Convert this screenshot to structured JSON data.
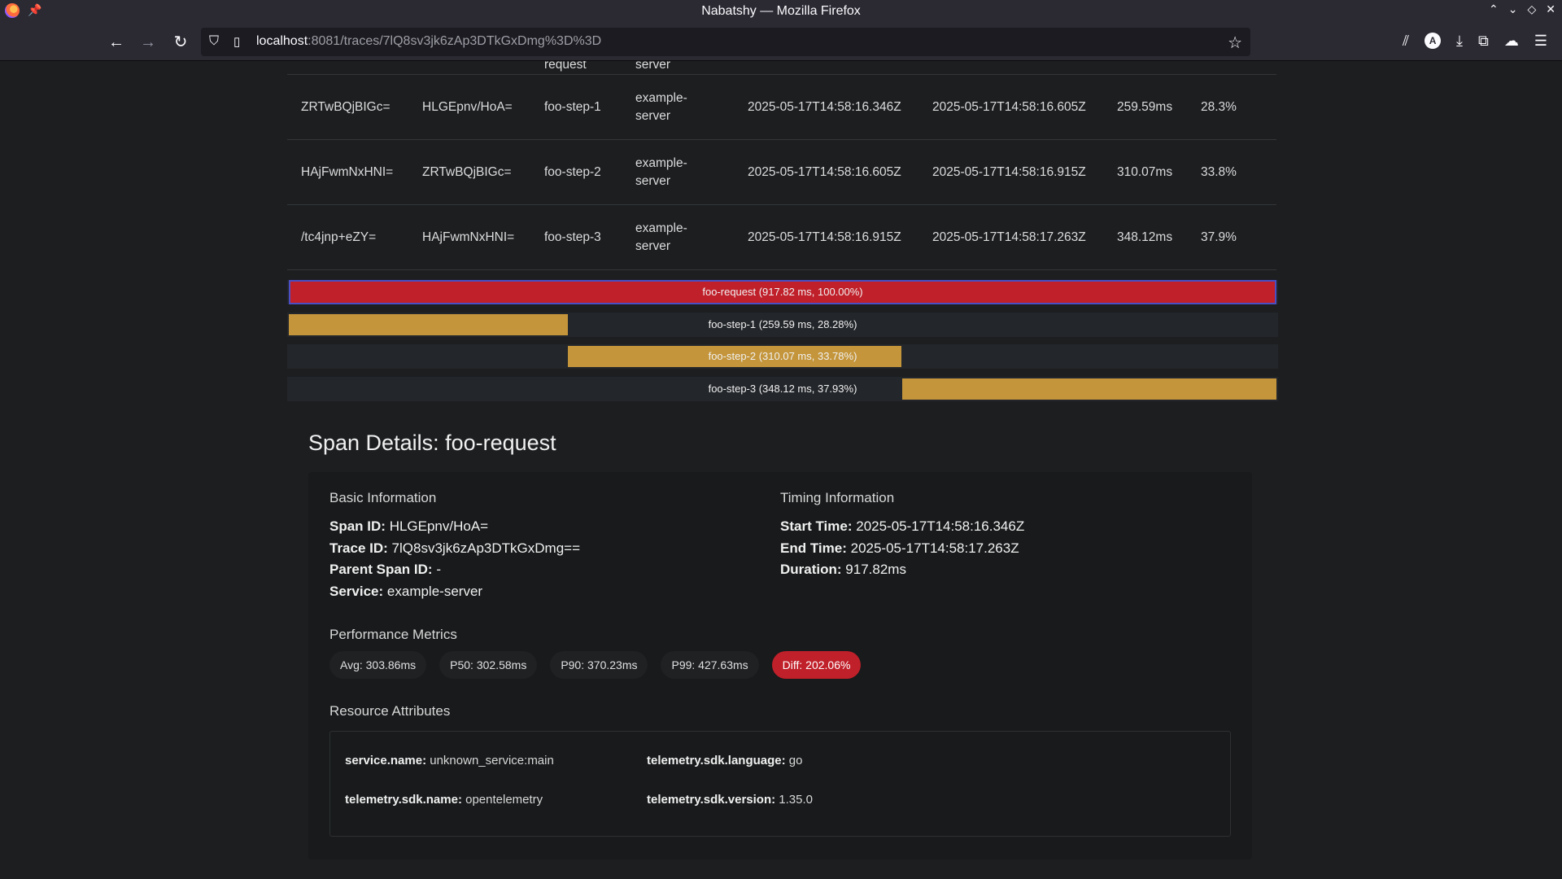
{
  "window": {
    "title": "Nabatshy — Mozilla Firefox"
  },
  "browser": {
    "url_host": "localhost",
    "url_rest": ":8081/traces/7lQ8sv3jk6zAp3DTkGxDmg%3D%3D"
  },
  "table": {
    "partial_row": {
      "name": "request",
      "service": "server"
    },
    "rows": [
      {
        "span_id": "ZRTwBQjBIGc=",
        "parent": "HLGEpnv/HoA=",
        "name": "foo-step-1",
        "service": "example-server",
        "start": "2025-05-17T14:58:16.346Z",
        "end": "2025-05-17T14:58:16.605Z",
        "duration": "259.59ms",
        "pct": "28.3%"
      },
      {
        "span_id": "HAjFwmNxHNI=",
        "parent": "ZRTwBQjBIGc=",
        "name": "foo-step-2",
        "service": "example-server",
        "start": "2025-05-17T14:58:16.605Z",
        "end": "2025-05-17T14:58:16.915Z",
        "duration": "310.07ms",
        "pct": "33.8%"
      },
      {
        "span_id": "/tc4jnp+eZY=",
        "parent": "HAjFwmNxHNI=",
        "name": "foo-step-3",
        "service": "example-server",
        "start": "2025-05-17T14:58:16.915Z",
        "end": "2025-05-17T14:58:17.263Z",
        "duration": "348.12ms",
        "pct": "37.9%"
      }
    ]
  },
  "waterfall": [
    {
      "label": "foo-request (917.82 ms, 100.00%)",
      "start_frac": 0.0,
      "width_frac": 1.0,
      "root": true
    },
    {
      "label": "foo-step-1 (259.59 ms, 28.28%)",
      "start_frac": 0.0,
      "width_frac": 0.2828,
      "root": false
    },
    {
      "label": "foo-step-2 (310.07 ms, 33.78%)",
      "start_frac": 0.2828,
      "width_frac": 0.3378,
      "root": false
    },
    {
      "label": "foo-step-3 (348.12 ms, 37.93%)",
      "start_frac": 0.6207,
      "width_frac": 0.3793,
      "root": false
    }
  ],
  "details": {
    "heading": "Span Details: foo-request",
    "basic_title": "Basic Information",
    "timing_title": "Timing Information",
    "span_id_label": "Span ID:",
    "span_id": "HLGEpnv/HoA=",
    "trace_id_label": "Trace ID:",
    "trace_id": "7lQ8sv3jk6zAp3DTkGxDmg==",
    "parent_label": "Parent Span ID:",
    "parent": "-",
    "service_label": "Service:",
    "service": "example-server",
    "start_label": "Start Time:",
    "start": "2025-05-17T14:58:16.346Z",
    "end_label": "End Time:",
    "end": "2025-05-17T14:58:17.263Z",
    "duration_label": "Duration:",
    "duration": "917.82ms",
    "perf_title": "Performance Metrics",
    "avg": "Avg: 303.86ms",
    "p50": "P50: 302.58ms",
    "p90": "P90: 370.23ms",
    "p99": "P99: 427.63ms",
    "diff": "Diff: 202.06%",
    "res_title": "Resource Attributes",
    "res": {
      "service_name_label": "service.name:",
      "service_name": "unknown_service:main",
      "sdk_language_label": "telemetry.sdk.language:",
      "sdk_language": "go",
      "sdk_name_label": "telemetry.sdk.name:",
      "sdk_name": "opentelemetry",
      "sdk_version_label": "telemetry.sdk.version:",
      "sdk_version": "1.35.0"
    }
  },
  "colors": {
    "root_bar": "#c0202a",
    "step_bar": "#c4953a",
    "diff_pill": "#c0202a"
  }
}
